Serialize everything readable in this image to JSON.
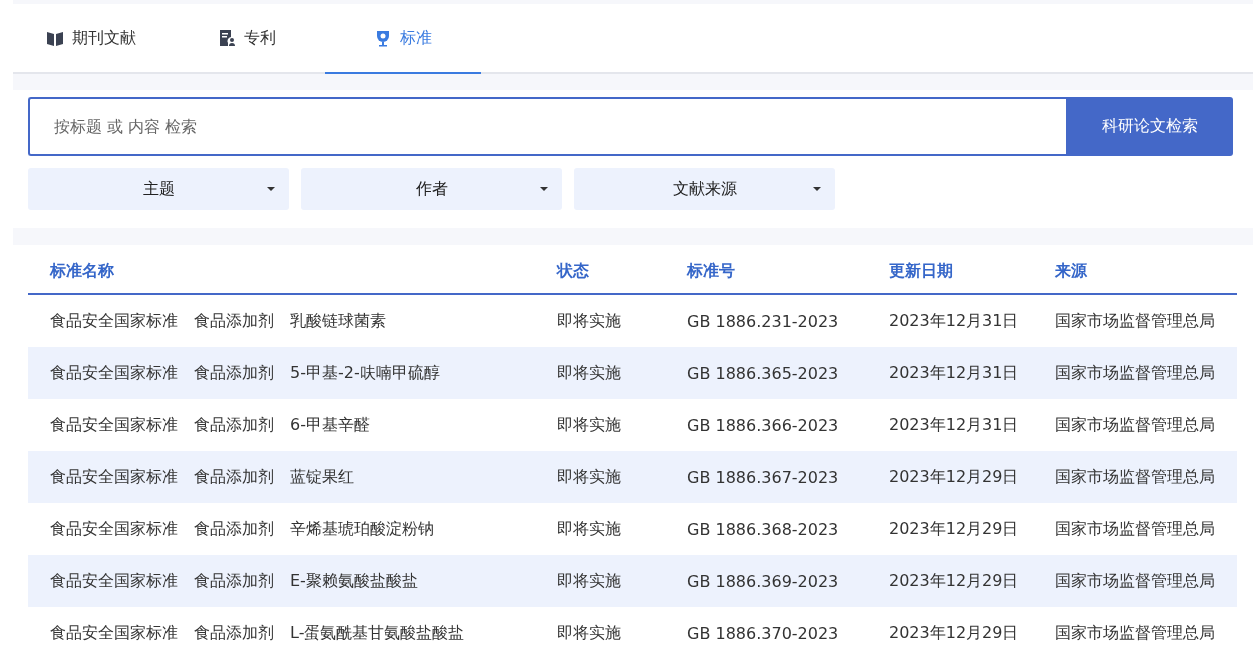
{
  "tabs": [
    {
      "label": "期刊文献",
      "selected": false
    },
    {
      "label": "专利",
      "selected": false
    },
    {
      "label": "标准",
      "selected": true
    }
  ],
  "search": {
    "placeholder": "按标题 或 内容 检索",
    "button": "科研论文检索"
  },
  "filters": [
    "主题",
    "作者",
    "文献来源"
  ],
  "table": {
    "columns": [
      "标准名称",
      "状态",
      "标准号",
      "更新日期",
      "来源"
    ],
    "rows": [
      [
        "食品安全国家标准　食品添加剂　乳酸链球菌素",
        "即将实施",
        "GB 1886.231-2023",
        "2023年12月31日",
        "国家市场监督管理总局"
      ],
      [
        "食品安全国家标准　食品添加剂　5-甲基-2-呋喃甲硫醇",
        "即将实施",
        "GB 1886.365-2023",
        "2023年12月31日",
        "国家市场监督管理总局"
      ],
      [
        "食品安全国家标准　食品添加剂　6-甲基辛醛",
        "即将实施",
        "GB 1886.366-2023",
        "2023年12月31日",
        "国家市场监督管理总局"
      ],
      [
        "食品安全国家标准　食品添加剂　蓝锭果红",
        "即将实施",
        "GB 1886.367-2023",
        "2023年12月29日",
        "国家市场监督管理总局"
      ],
      [
        "食品安全国家标准　食品添加剂　辛烯基琥珀酸淀粉钠",
        "即将实施",
        "GB 1886.368-2023",
        "2023年12月29日",
        "国家市场监督管理总局"
      ],
      [
        "食品安全国家标准　食品添加剂　E-聚赖氨酸盐酸盐",
        "即将实施",
        "GB 1886.369-2023",
        "2023年12月29日",
        "国家市场监督管理总局"
      ],
      [
        "食品安全国家标准　食品添加剂　L-蛋氨酰基甘氨酸盐酸盐",
        "即将实施",
        "GB 1886.370-2023",
        "2023年12月29日",
        "国家市场监督管理总局"
      ]
    ]
  }
}
